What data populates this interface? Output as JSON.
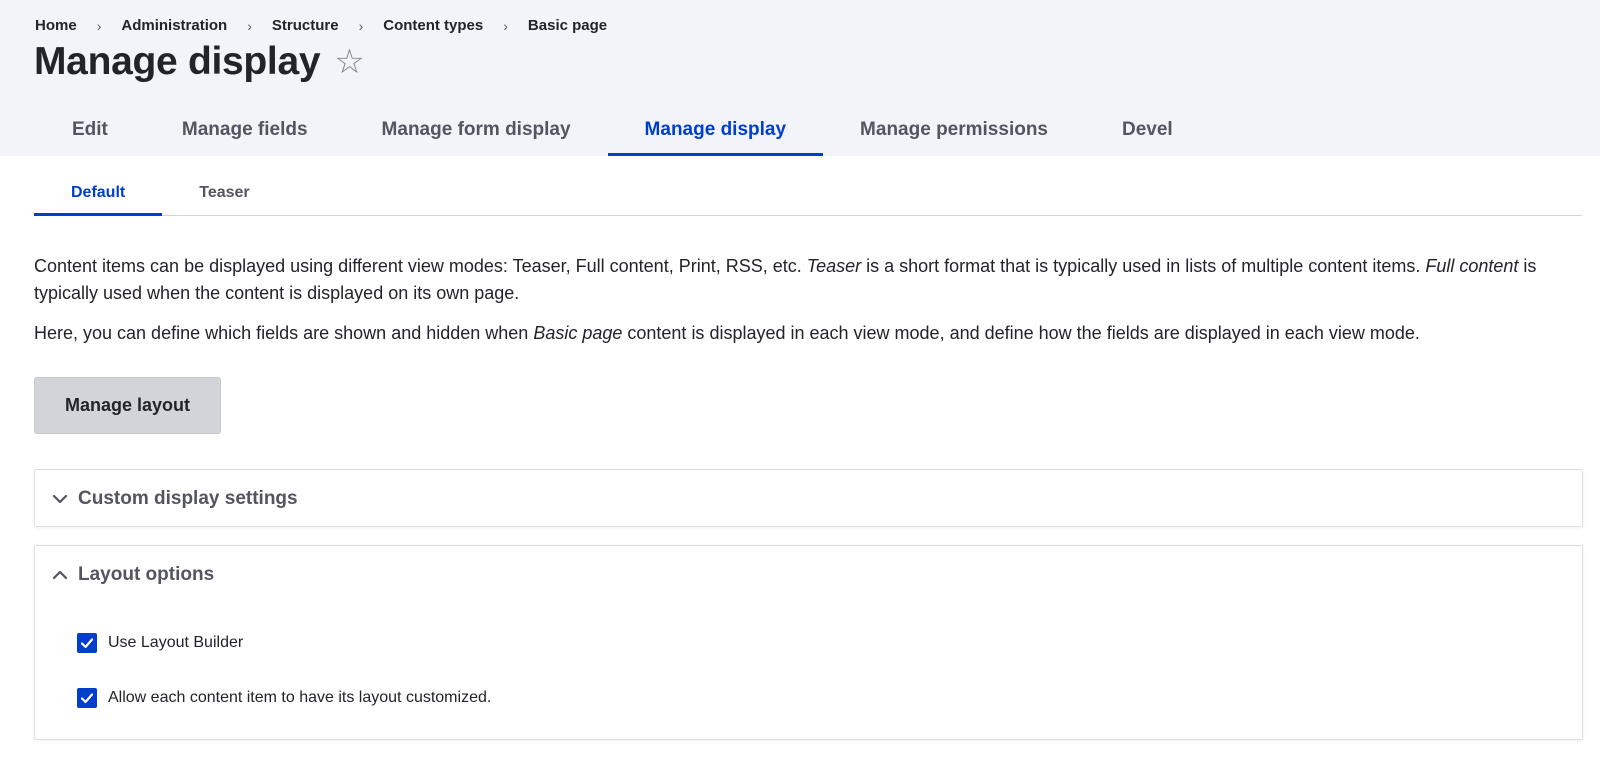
{
  "breadcrumb": {
    "items": [
      "Home",
      "Administration",
      "Structure",
      "Content types",
      "Basic page"
    ],
    "separator": "›"
  },
  "page": {
    "title": "Manage display",
    "favorite_icon": "star-outline-icon"
  },
  "primary_tabs": [
    {
      "label": "Edit",
      "active": false
    },
    {
      "label": "Manage fields",
      "active": false
    },
    {
      "label": "Manage form display",
      "active": false
    },
    {
      "label": "Manage display",
      "active": true
    },
    {
      "label": "Manage permissions",
      "active": false
    },
    {
      "label": "Devel",
      "active": false
    }
  ],
  "secondary_tabs": [
    {
      "label": "Default",
      "active": true
    },
    {
      "label": "Teaser",
      "active": false
    }
  ],
  "description": {
    "p1_a": "Content items can be displayed using different view modes: Teaser, Full content, Print, RSS, etc. ",
    "p1_b": "Teaser",
    "p1_c": " is a short format that is typically used in lists of multiple content items. ",
    "p1_d": "Full content",
    "p1_e": " is typically used when the content is displayed on its own page.",
    "p2_a": "Here, you can define which fields are shown and hidden when ",
    "p2_b": "Basic page",
    "p2_c": " content is displayed in each view mode, and define how the fields are displayed in each view mode."
  },
  "buttons": {
    "manage_layout": "Manage layout"
  },
  "sections": {
    "custom_display": {
      "label": "Custom display settings",
      "expanded": false,
      "icon": "chevron-down-icon"
    },
    "layout_options": {
      "label": "Layout options",
      "expanded": true,
      "icon": "chevron-up-icon",
      "checkboxes": [
        {
          "label": "Use Layout Builder",
          "checked": true
        },
        {
          "label": "Allow each content item to have its layout customized.",
          "checked": true
        }
      ]
    }
  },
  "colors": {
    "accent": "#003ecc",
    "header_bg": "#f3f4f9",
    "text": "#232429",
    "muted_text": "#545560",
    "button_bg": "#d3d4d9"
  }
}
